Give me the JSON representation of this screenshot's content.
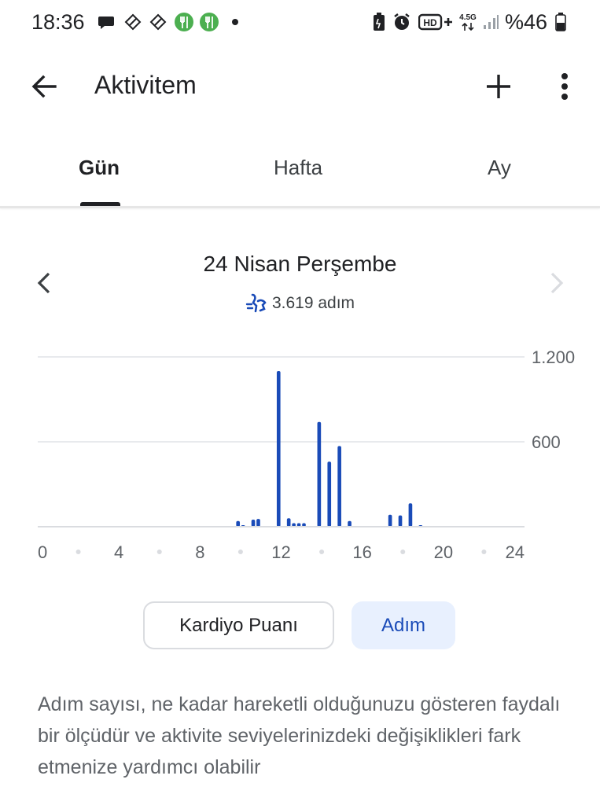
{
  "status_bar": {
    "time": "18:36",
    "battery": "%46",
    "network": "4.5G",
    "icons": [
      "chat-icon",
      "fitness-app-icon",
      "fitness-app-icon",
      "restaurant-icon",
      "restaurant-icon",
      "dot-icon",
      "battery-saver-icon",
      "alarm-icon",
      "hd-plus-icon",
      "signal-icon",
      "battery-icon"
    ]
  },
  "app_bar": {
    "title": "Aktivitem",
    "icons": [
      "back-arrow-icon",
      "plus-icon",
      "more-vert-icon"
    ]
  },
  "tabs": [
    {
      "label": "Gün",
      "selected": true
    },
    {
      "label": "Hafta",
      "selected": false
    },
    {
      "label": "Ay",
      "selected": false
    }
  ],
  "date_nav": {
    "title": "24 Nisan Perşembe",
    "summary": "3.619 adım",
    "summary_icon": "steps-icon",
    "prev_icon": "chevron-left-icon",
    "next_icon": "chevron-right-icon"
  },
  "colors": {
    "accent": "#1a4bb8",
    "bar": "#1a4bb8",
    "selected_button_bg": "#e8f0fe",
    "text_secondary": "#5f6368"
  },
  "chart_data": {
    "type": "bar",
    "xlabel": "",
    "ylabel": "",
    "xlim": [
      0,
      24
    ],
    "ylim": [
      0,
      1200
    ],
    "x_ticks": [
      "0",
      "4",
      "8",
      "12",
      "16",
      "20",
      "24"
    ],
    "y_ticks": [
      "1.200",
      "600"
    ],
    "grid": true,
    "bar_interval_minutes": 15,
    "x": [
      9.75,
      10.0,
      10.5,
      10.75,
      11.75,
      12.25,
      12.5,
      12.75,
      13.0,
      13.75,
      14.25,
      14.75,
      15.25,
      17.25,
      17.75,
      18.25,
      18.75
    ],
    "values": [
      40,
      10,
      50,
      55,
      1100,
      60,
      25,
      25,
      25,
      740,
      460,
      570,
      40,
      85,
      80,
      165,
      5
    ]
  },
  "toggle": {
    "cardio_label": "Kardiyo Puanı",
    "steps_label": "Adım",
    "selected": "Adım"
  },
  "description": "Adım sayısı, ne kadar hareketli olduğunuzu gösteren faydalı bir ölçüdür ve aktivite seviyelerinizdeki değişiklikleri fark etmenize yardımcı olabilir"
}
